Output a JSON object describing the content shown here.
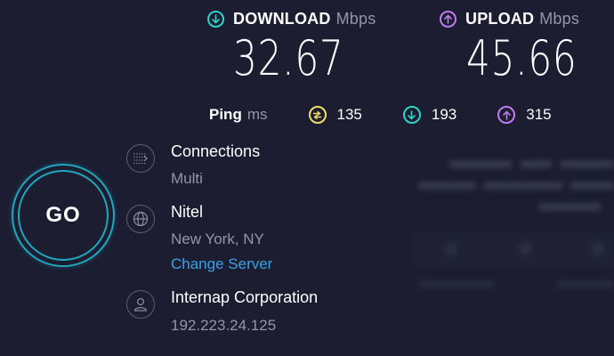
{
  "download": {
    "label": "DOWNLOAD",
    "unit": "Mbps",
    "value": "32.67",
    "color": "#2ed3c8"
  },
  "upload": {
    "label": "UPLOAD",
    "unit": "Mbps",
    "value": "45.66",
    "color": "#c07bf2"
  },
  "ping": {
    "label": "Ping",
    "unit": "ms",
    "idle": "135",
    "download": "193",
    "upload": "315",
    "idle_color": "#f3dd6a"
  },
  "go_button": {
    "label": "GO"
  },
  "connections": {
    "title": "Connections",
    "value": "Multi"
  },
  "server": {
    "name": "Nitel",
    "location": "New York, NY",
    "change_label": "Change Server"
  },
  "provider": {
    "name": "Internap Corporation",
    "ip": "192.223.24.125"
  }
}
